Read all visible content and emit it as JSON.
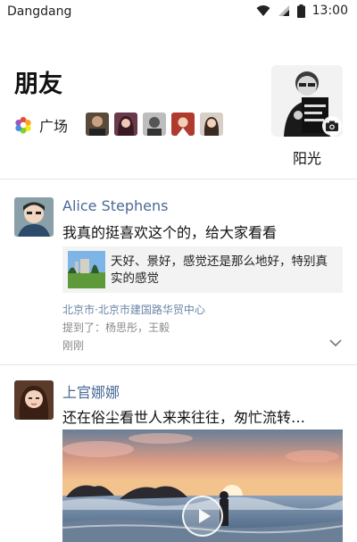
{
  "status_bar": {
    "app_name": "Dangdang",
    "time": "13:00"
  },
  "header": {
    "title": "朋友",
    "plaza_label": "广场",
    "profile_name": "阳光"
  },
  "posts": [
    {
      "author": "Alice Stephens",
      "text": "我真的挺喜欢这个的，给大家看看",
      "link_text": "天好、景好，感觉还是那么地好，特别真实的感觉",
      "location": "北京市·北京市建国路华贸中心",
      "mentions": "提到了：杨思彤，王毅",
      "time": "刚刚"
    },
    {
      "author": "上官娜娜",
      "text": "还在俗尘看世人来来往往，匆忙流转…"
    }
  ],
  "colors": {
    "name_blue": "#4a6a96",
    "location_blue": "#6b84a8",
    "meta_grey": "#888888"
  }
}
